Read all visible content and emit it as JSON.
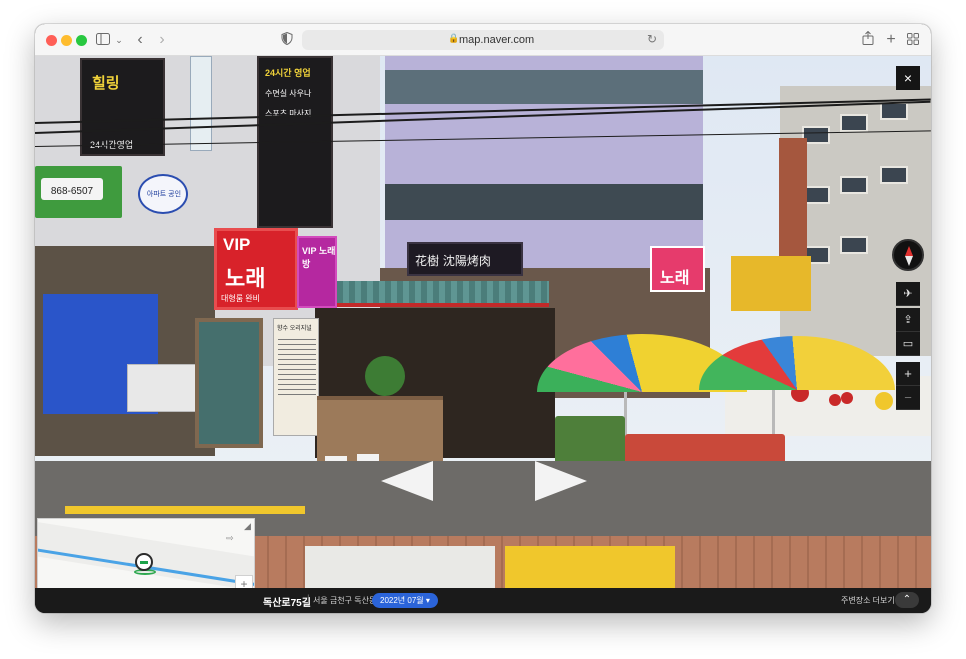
{
  "browser": {
    "url": "map.naver.com",
    "icons": [
      "sidebar-icon",
      "chevron-down-icon",
      "back-icon",
      "forward-icon",
      "shield-icon",
      "lock-icon",
      "reload-icon",
      "share-icon",
      "new-tab-icon",
      "tab-overview-icon"
    ]
  },
  "streetview": {
    "signs": {
      "store1": "힐링",
      "store1_hours": "24시간영업",
      "store2": "24시간 영업",
      "store2_sub": "수면실 사우나",
      "store2_sub2": "스포츠 마사지",
      "phone": "868-6507",
      "oval": "아파트 공인",
      "vip": "VIP",
      "vip_word": "노래",
      "vip_sub": "대형룸 완비",
      "vip2": "VIP 노래방",
      "center_sign": "花樹 沈陽烤肉",
      "right_sign": "노래",
      "menu_title": "향수 오리지널"
    },
    "controls": {
      "close": "×",
      "zoom_in": "+",
      "zoom_out": "−"
    },
    "accent_colors": {
      "date_pill": "#2b64d9",
      "compass_north": "#e0312f"
    }
  },
  "minimap": {
    "zoom_in": "+",
    "zoom_out": "−"
  },
  "bottombar": {
    "road_name": "독산로75길",
    "separator": "|",
    "address": "서울 금천구 독산동",
    "date": "2022년 07월 ▾",
    "more": "주변장소 더보기",
    "toggle": "⌃"
  }
}
